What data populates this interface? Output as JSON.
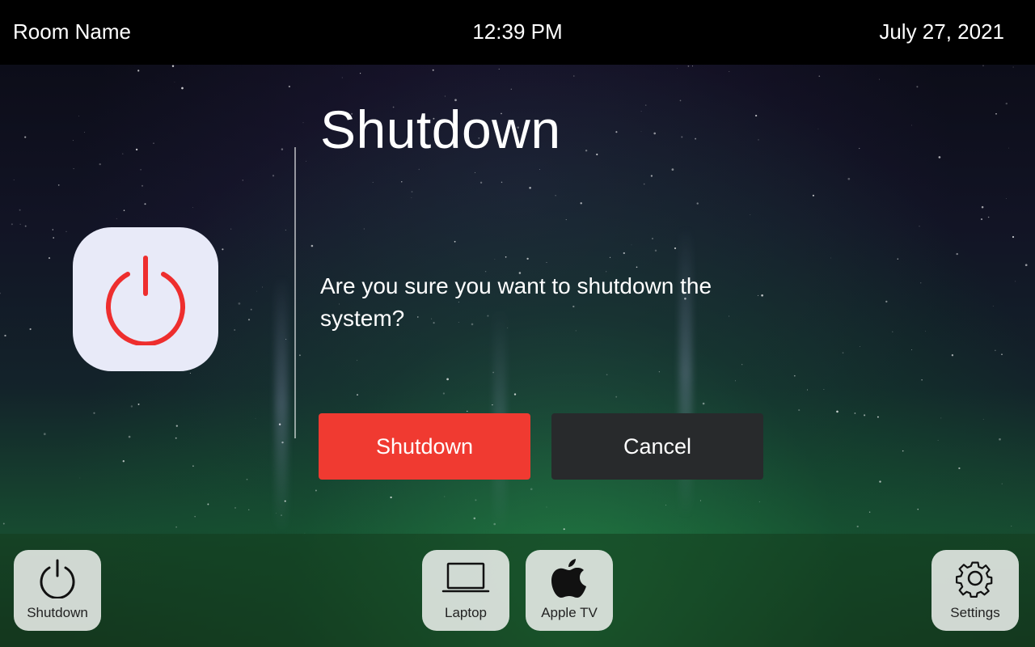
{
  "header": {
    "room_name": "Room Name",
    "time": "12:39 PM",
    "date": "July 27, 2021"
  },
  "dialog": {
    "title": "Shutdown",
    "message": "Are you sure you want to shutdown the system?",
    "icon": "power-icon",
    "confirm_label": "Shutdown",
    "cancel_label": "Cancel"
  },
  "bottom_nav": {
    "shutdown": {
      "label": "Shutdown",
      "icon": "power-icon"
    },
    "laptop": {
      "label": "Laptop",
      "icon": "laptop-icon"
    },
    "apple_tv": {
      "label": "Apple TV",
      "icon": "apple-icon"
    },
    "settings": {
      "label": "Settings",
      "icon": "gear-icon"
    }
  },
  "colors": {
    "accent_red": "#f03a31",
    "cancel_dark": "#282a2c",
    "tile_bg": "#e8eaf8"
  }
}
